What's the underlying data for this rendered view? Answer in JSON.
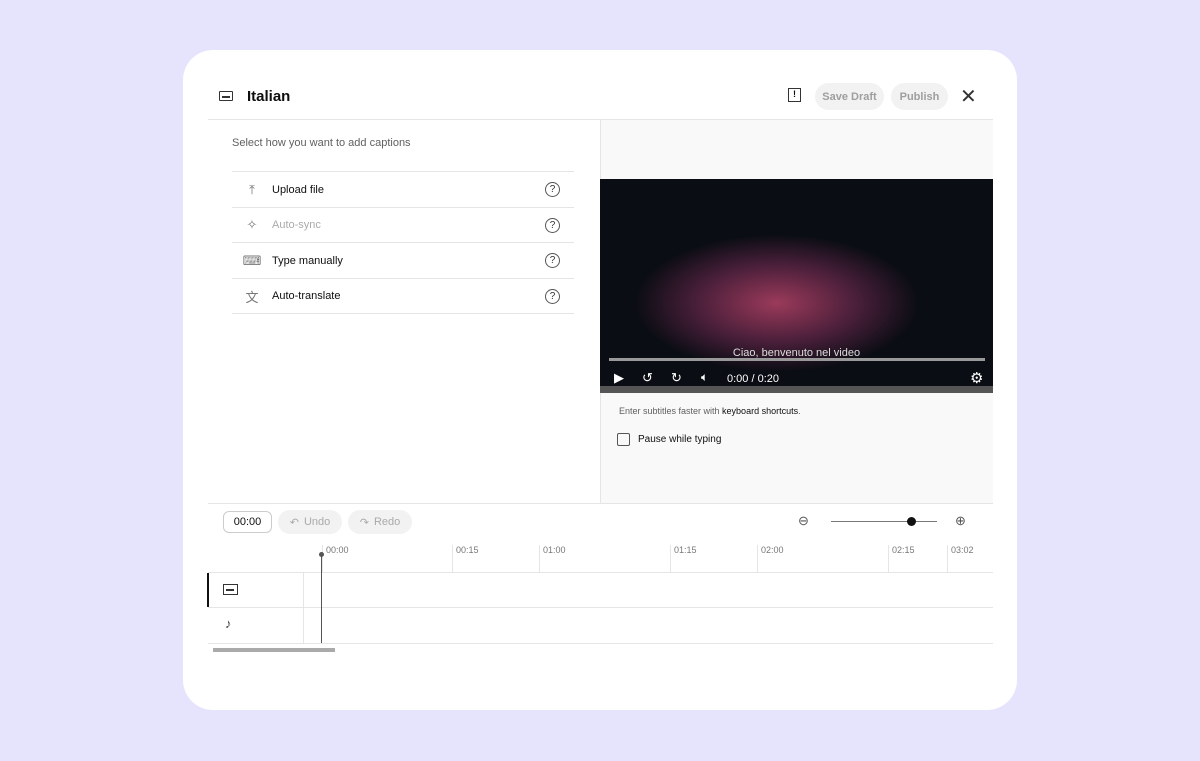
{
  "header": {
    "title": "Italian",
    "icon": "subtitles-icon",
    "save_draft": "Save Draft",
    "publish": "Publish"
  },
  "left": {
    "subtitle": "Select how you want to add captions",
    "options": [
      {
        "label": "Upload file",
        "icon": "upload-icon",
        "disabled": false
      },
      {
        "label": "Auto-sync",
        "icon": "sparkle-icon",
        "disabled": true
      },
      {
        "label": "Type manually",
        "icon": "keyboard-icon",
        "disabled": false
      },
      {
        "label": "Auto-translate",
        "icon": "translate-icon",
        "disabled": false
      }
    ]
  },
  "player": {
    "caption": "Ciao, benvenuto nel video",
    "time": "0:00 / 0:20",
    "progress": 0
  },
  "hint": {
    "prefix": "Enter subtitles faster with ",
    "link": "keyboard shortcuts",
    "suffix": "."
  },
  "pause_label": "Pause while typing",
  "pause_checked": false,
  "timeline": {
    "current": "00:00",
    "undo": "Undo",
    "redo": "Redo",
    "zoom_level": 0.75,
    "ticks": [
      "00:00",
      "00:15",
      "01:00",
      "01:15",
      "02:00",
      "02:15",
      "03:02"
    ]
  }
}
